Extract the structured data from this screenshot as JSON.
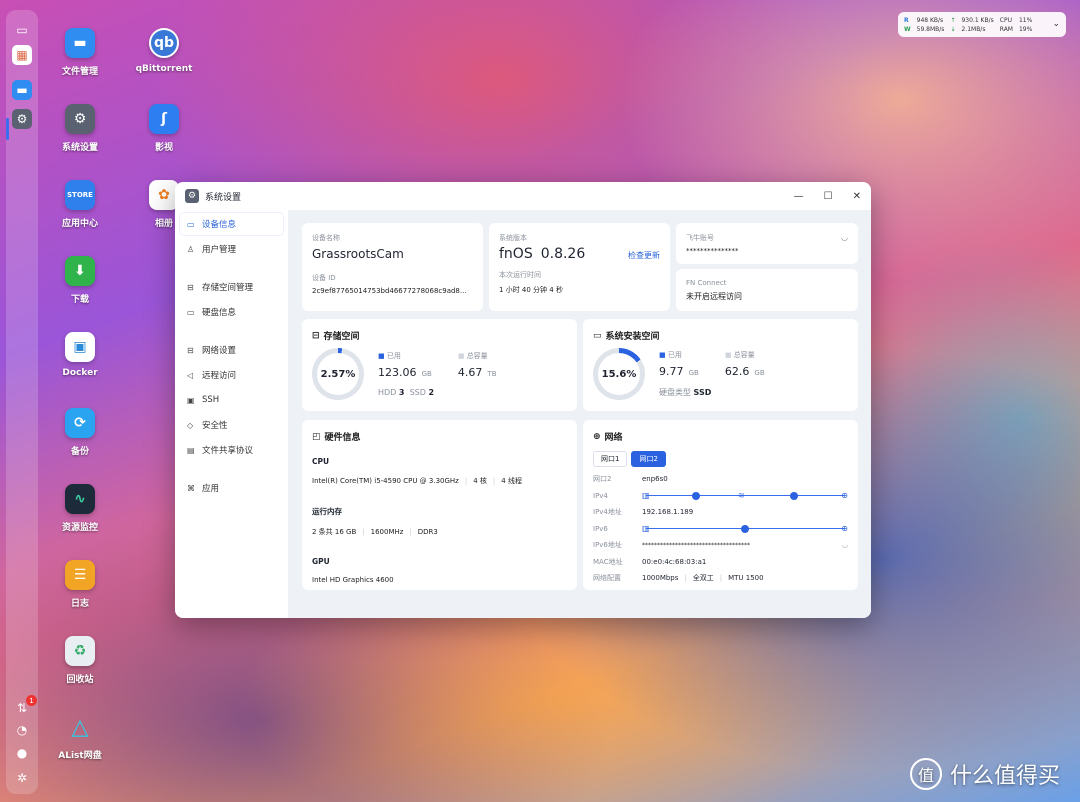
{
  "monitor": {
    "r_label": "R",
    "w_label": "W",
    "r_speed": "948 KB/s",
    "w_speed": "59.8MB/s",
    "up1": "930.1 KB/s",
    "up2": "2.1MB/s",
    "cpu_label": "CPU",
    "ram_label": "RAM",
    "cpu": "11%",
    "ram": "19%"
  },
  "desktop": [
    {
      "label": "文件管理",
      "icon": "folder-icon",
      "color": "#2f8cf0"
    },
    {
      "label": "qBittorrent",
      "icon": "qbittorrent-icon",
      "color": "#3a78d8"
    },
    {
      "label": "系统设置",
      "icon": "gear-icon",
      "color": "#5a6170"
    },
    {
      "label": "影视",
      "icon": "video-icon",
      "color": "#2d7ef0"
    },
    {
      "label": "应用中心",
      "icon": "store-icon",
      "color": "#2f80ed"
    },
    {
      "label": "相册",
      "icon": "photos-icon",
      "color": "#f0a020"
    },
    {
      "label": "下载",
      "icon": "download-icon",
      "color": "#2fb34a"
    },
    {
      "label": "Docker",
      "icon": "docker-icon",
      "color": "#ffffff"
    },
    {
      "label": "备份",
      "icon": "backup-icon",
      "color": "#2aa3f0"
    },
    {
      "label": "资源监控",
      "icon": "monitor-icon",
      "color": "#1d2a3a"
    },
    {
      "label": "日志",
      "icon": "log-icon",
      "color": "#f2a424"
    },
    {
      "label": "回收站",
      "icon": "trash-icon",
      "color": "#e8eef2"
    },
    {
      "label": "AList网盘",
      "icon": "alist-icon",
      "color": "#2aa6c8"
    }
  ],
  "dock": {
    "badge": "1"
  },
  "window": {
    "title": "系统设置",
    "nav": [
      {
        "label": "设备信息",
        "icon": "device-icon"
      },
      {
        "label": "用户管理",
        "icon": "user-icon"
      },
      {
        "label": "存储空间管理",
        "icon": "storage-icon"
      },
      {
        "label": "硬盘信息",
        "icon": "disk-icon"
      },
      {
        "label": "网络设置",
        "icon": "network-icon"
      },
      {
        "label": "远程访问",
        "icon": "remote-icon"
      },
      {
        "label": "SSH",
        "icon": "ssh-icon"
      },
      {
        "label": "安全性",
        "icon": "shield-icon"
      },
      {
        "label": "文件共享协议",
        "icon": "share-icon"
      },
      {
        "label": "应用",
        "icon": "apps-icon"
      }
    ],
    "device": {
      "name_label": "设备名称",
      "name": "GrassrootsCam",
      "id_label": "设备 ID",
      "id": "2c9ef87765014753bd46677278068c9ad8..."
    },
    "version": {
      "label": "系统版本",
      "name": "fnOS",
      "number": "0.8.26",
      "check": "检查更新",
      "uptime_label": "本次运行时间",
      "uptime": "1 小时 40 分钟 4 秒"
    },
    "account": {
      "label": "飞牛账号",
      "value": "***************"
    },
    "connect": {
      "label": "FN Connect",
      "value": "未开启远程访问"
    },
    "storage": {
      "title": "存储空间",
      "percent": "2.57%",
      "percent_value": 2.57,
      "used_label": "已用",
      "used": "123.06",
      "used_unit": "GB",
      "total_label": "总容量",
      "total": "4.67",
      "total_unit": "TB",
      "hdd_label": "HDD",
      "hdd": "3",
      "ssd_label": "SSD",
      "ssd": "2"
    },
    "sysdisk": {
      "title": "系统安装空间",
      "percent": "15.6%",
      "percent_value": 15.6,
      "used_label": "已用",
      "used": "9.77",
      "used_unit": "GB",
      "total_label": "总容量",
      "total": "62.6",
      "total_unit": "GB",
      "type_label": "硬盘类型",
      "type": "SSD"
    },
    "hardware": {
      "title": "硬件信息",
      "cpu_label": "CPU",
      "cpu": "Intel(R) Core(TM) i5-4590 CPU @ 3.30GHz",
      "cores": "4 核",
      "threads": "4 线程",
      "mem_label": "运行内存",
      "mem": "2 条共 16 GB",
      "mem_speed": "1600MHz",
      "mem_type": "DDR3",
      "gpu_label": "GPU",
      "gpu": "Intel HD Graphics 4600"
    },
    "network": {
      "title": "网络",
      "tabs": [
        "网口1",
        "网口2"
      ],
      "port_label": "网口2",
      "port": "enp6s0",
      "ipv4_label": "IPv4",
      "ipv4addr_label": "IPv4地址",
      "ipv4addr": "192.168.1.189",
      "ipv6_label": "IPv6",
      "ipv6addr_label": "IPv6地址",
      "ipv6addr": "************************************",
      "mac_label": "MAC地址",
      "mac": "00:e0:4c:68:03:a1",
      "config_label": "网络配置",
      "speed": "1000Mbps",
      "duplex": "全双工",
      "mtu": "MTU 1500"
    }
  },
  "watermark": {
    "text": "什么值得买",
    "logo": "值"
  }
}
